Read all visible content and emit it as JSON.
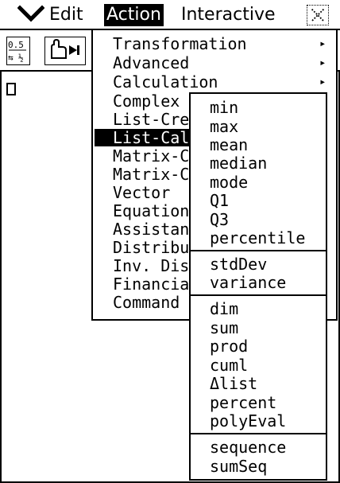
{
  "menubar": {
    "edit": "Edit",
    "action": "Action",
    "interactive": "Interactive",
    "chevron_icon": "chevron-down-icon",
    "close_icon": "close-icon"
  },
  "toolbar": {
    "frac_icon": "fraction-decimal-icon",
    "hand_icon": "hand-play-icon"
  },
  "menu": {
    "items": [
      {
        "label": "Transformation"
      },
      {
        "label": "Advanced"
      },
      {
        "label": "Calculation"
      },
      {
        "label": "Complex"
      },
      {
        "label": "List-Create"
      },
      {
        "label": "List-Calculation"
      },
      {
        "label": "Matrix-Create"
      },
      {
        "label": "Matrix-Calculation"
      },
      {
        "label": "Vector"
      },
      {
        "label": "Equation/Inequality"
      },
      {
        "label": "Assistant"
      },
      {
        "label": "Distribution"
      },
      {
        "label": "Inv. Distribution"
      },
      {
        "label": "Financial"
      },
      {
        "label": "Command"
      }
    ],
    "submenu_arrow": "▸"
  },
  "submenu": {
    "group1": [
      "min",
      "max",
      "mean",
      "median",
      "mode",
      "Q1",
      "Q3",
      "percentile"
    ],
    "group2": [
      "stdDev",
      "variance"
    ],
    "group3": [
      "dim",
      "sum",
      "prod",
      "cuml",
      "Δlist",
      "percent",
      "polyEval"
    ],
    "group4": [
      "sequence",
      "sumSeq"
    ]
  }
}
